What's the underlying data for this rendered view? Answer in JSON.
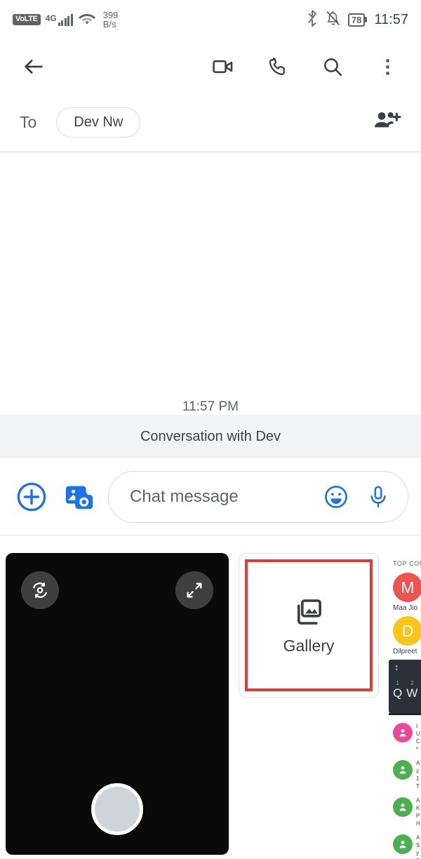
{
  "status_bar": {
    "volte_label": "VoLTE",
    "network_type": "4G",
    "data_rate_value": "399",
    "data_rate_unit": "B/s",
    "battery_level": "78",
    "clock": "11:57"
  },
  "toolbar": {
    "back_label": "Back",
    "video_call_label": "Video call",
    "voice_call_label": "Call",
    "search_label": "Search",
    "more_label": "More options"
  },
  "recipient": {
    "to_label": "To",
    "chip_name": "Dev Nw",
    "add_people_label": "Add people"
  },
  "conversation": {
    "timestamp": "11:57 PM",
    "banner": "Conversation with Dev"
  },
  "compose": {
    "add_label": "Add attachment",
    "gallery_toggle_label": "Photos and camera",
    "placeholder": "Chat message",
    "emoji_label": "Emoji",
    "mic_label": "Voice message"
  },
  "attach_panel": {
    "camera": {
      "flip_label": "Switch camera",
      "expand_label": "Expand camera",
      "shutter_label": "Take photo"
    },
    "gallery": {
      "label": "Gallery",
      "icon": "gallery-icon",
      "highlight_color": "#e53935"
    }
  },
  "peek_panel": {
    "section_title": "TOP CONTA",
    "top_contacts": [
      {
        "initial": "M",
        "name": "Maa Jio",
        "color": "#ef5350"
      },
      {
        "initial": "D",
        "name": "Dilpreet",
        "color": "#fcc419"
      }
    ],
    "keyboard": {
      "keys": [
        {
          "num": "1",
          "letter": "Q"
        },
        {
          "num": "2",
          "letter": "W"
        }
      ]
    },
    "contacts": [
      {
        "color": "#ec4899",
        "lines": [
          "I",
          "U",
          "C",
          "*"
        ]
      },
      {
        "color": "#4caf50",
        "lines": [
          "A",
          "z",
          "1",
          "T"
        ]
      },
      {
        "color": "#4caf50",
        "lines": [
          "A",
          "K",
          "P",
          "H"
        ]
      },
      {
        "color": "#4caf50",
        "lines": [
          "A",
          "S",
          "y",
          "D"
        ]
      }
    ]
  }
}
